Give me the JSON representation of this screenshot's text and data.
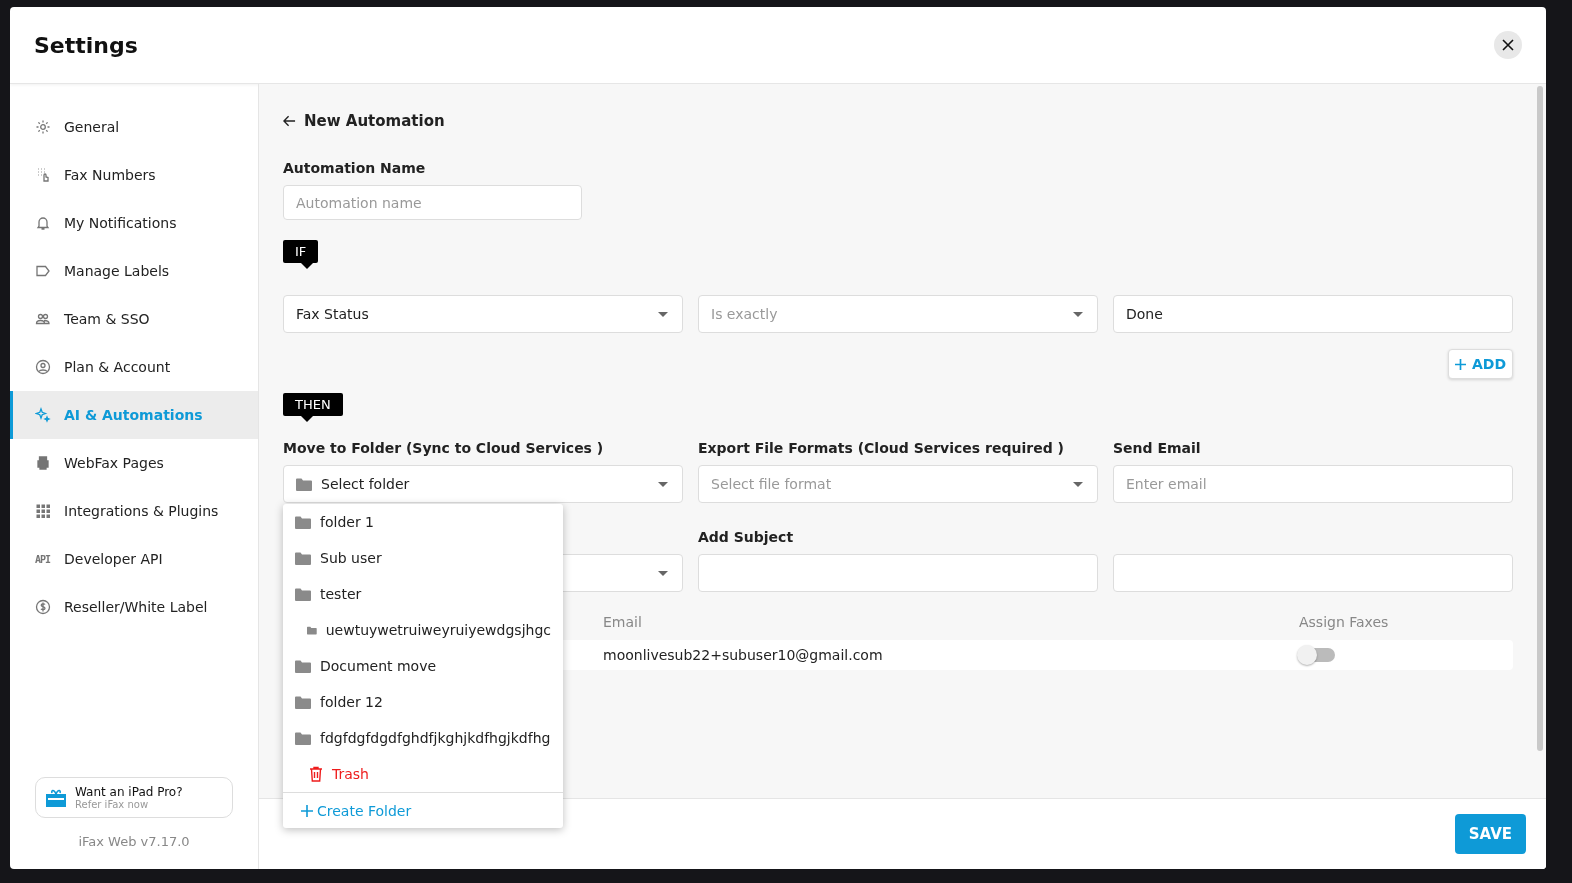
{
  "window": {
    "title": "Settings"
  },
  "sidebar": {
    "items": [
      {
        "label": "General",
        "selected": false
      },
      {
        "label": "Fax Numbers",
        "selected": false
      },
      {
        "label": "My Notifications",
        "selected": false
      },
      {
        "label": "Manage Labels",
        "selected": false
      },
      {
        "label": "Team & SSO",
        "selected": false
      },
      {
        "label": "Plan & Account",
        "selected": false
      },
      {
        "label": "AI & Automations",
        "selected": true
      },
      {
        "label": "WebFax Pages",
        "selected": false
      },
      {
        "label": "Integrations & Plugins",
        "selected": false
      },
      {
        "label": "Developer API",
        "icon_text": "API",
        "selected": false
      },
      {
        "label": "Reseller/White Label",
        "selected": false
      }
    ],
    "promo": {
      "title": "Want an iPad Pro?",
      "subtitle": "Refer iFax now"
    },
    "version": "iFax Web v7.17.0"
  },
  "page": {
    "back_title": "New Automation",
    "name_label": "Automation Name",
    "name_placeholder": "Automation name",
    "if_badge": "IF",
    "conditions": [
      {
        "kind": "select",
        "value": "Fax Status",
        "disabled": false
      },
      {
        "kind": "select",
        "value": "Is exactly",
        "disabled": true
      },
      {
        "kind": "text",
        "value": "Done"
      }
    ],
    "add_button": "ADD",
    "then_badge": "THEN",
    "actions": [
      {
        "kind": "folder-select",
        "label": "Move to Folder (Sync to Cloud Services )",
        "placeholder": "Select folder"
      },
      {
        "kind": "select",
        "label": "Export File Formats (Cloud Services required )",
        "placeholder": "Select file format"
      },
      {
        "kind": "input",
        "label": "Send Email",
        "placeholder": "Enter email"
      },
      {
        "kind": "select"
      },
      {
        "kind": "input",
        "label": "Add Subject"
      },
      {
        "kind": "input"
      }
    ],
    "table": {
      "columns": [
        "Email",
        "Assign Faxes"
      ],
      "rows": [
        {
          "email": "moonlivesub22+subuser10@gmail.com",
          "assign": false
        }
      ]
    },
    "folder_menu": {
      "items": [
        {
          "kind": "folder",
          "label": "folder 1"
        },
        {
          "kind": "folder",
          "label": "Sub user"
        },
        {
          "kind": "folder",
          "label": "tester",
          "children": [
            {
              "kind": "folder",
              "label": "uewtuywetruiweyruiyewdgsjhgc"
            }
          ]
        },
        {
          "kind": "folder",
          "label": "Document move"
        },
        {
          "kind": "folder",
          "label": "folder 12"
        },
        {
          "kind": "folder",
          "label": "fdgfdgfdgdfghdfjkghjkdfhgjkdfhg"
        },
        {
          "kind": "trash",
          "label": "Trash"
        }
      ],
      "create": "Create Folder"
    }
  },
  "save_button": "SAVE"
}
